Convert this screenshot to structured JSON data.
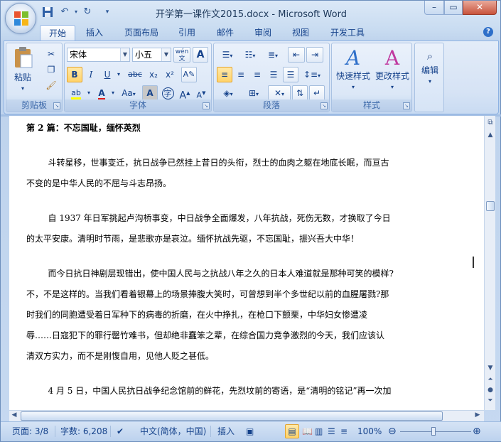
{
  "window": {
    "title": "开学第一课作文2015.docx - Microsoft Word"
  },
  "qat": {
    "save_icon": "save-icon",
    "undo_icon": "undo-icon",
    "redo_icon": "redo-icon",
    "customize_icon": "chevron-down-icon"
  },
  "tabs": [
    {
      "label": "开始",
      "active": true
    },
    {
      "label": "插入"
    },
    {
      "label": "页面布局"
    },
    {
      "label": "引用"
    },
    {
      "label": "邮件"
    },
    {
      "label": "审阅"
    },
    {
      "label": "视图"
    },
    {
      "label": "开发工具"
    }
  ],
  "ribbon": {
    "clipboard": {
      "group_label": "剪贴板",
      "paste_label": "粘贴"
    },
    "font": {
      "group_label": "字体",
      "font_name": "宋体",
      "font_size": "小五",
      "wen_label": "wén",
      "bold": "B",
      "italic": "I",
      "underline": "U",
      "strike": "abc",
      "sub": "x₂",
      "sup": "x²",
      "change_case": "Aa",
      "char_shade": "A",
      "enclose": "字",
      "grow": "A",
      "shrink": "A"
    },
    "paragraph": {
      "group_label": "段落"
    },
    "styles": {
      "group_label": "样式",
      "quick_styles_label": "快速样式",
      "change_styles_label": "更改样式"
    },
    "editing": {
      "label": "编辑"
    }
  },
  "document": {
    "paragraphs": [
      "第 2 篇：不忘国耻，缅怀英烈",
      "        斗转星移，世事变迁，抗日战争已然挂上昔日的头衔，烈士的血肉之躯在地底长眠，而亘古",
      "不变的是中华人民的不屈与斗志昂扬。",
      "        自 1937 年日军挑起卢沟桥事变，中日战争全面爆发，八年抗战，死伤无数，才换取了今日",
      "的太平安康。清明时节雨，是悲歌亦是哀泣。缅怀抗战先驱，不忘国耻，振兴吾大中华！",
      "        而今日抗日神剧层现错出，使中国人民与之抗战八年之久的日本人难道就是那种可笑的模样?",
      "不，不是这样的。当我们看着银幕上的场景捧腹大笑时，可曾想到半个多世纪以前的血腥屠戮?那",
      "时我们的同胞遭受着日军种下的病毒的折磨，在火中挣扎，在枪口下颤栗，中华妇女惨遭凌",
      "辱……日寇犯下的罪行罄竹难书，但却绝非蠢笨之辈，在综合国力竞争激烈的今天，我们应该认",
      "清双方实力，而不是刚愎自用，见他人贬之甚低。",
      "        4 月 5 日，中国人民抗日战争纪念馆前的鲜花，先烈坟前的寄语，是“清明的铭记”再一次加"
    ]
  },
  "status": {
    "page": "页面: 3/8",
    "words": "字数: 6,208",
    "language": "中文(简体，中国)",
    "mode": "插入",
    "zoom": "100%"
  }
}
